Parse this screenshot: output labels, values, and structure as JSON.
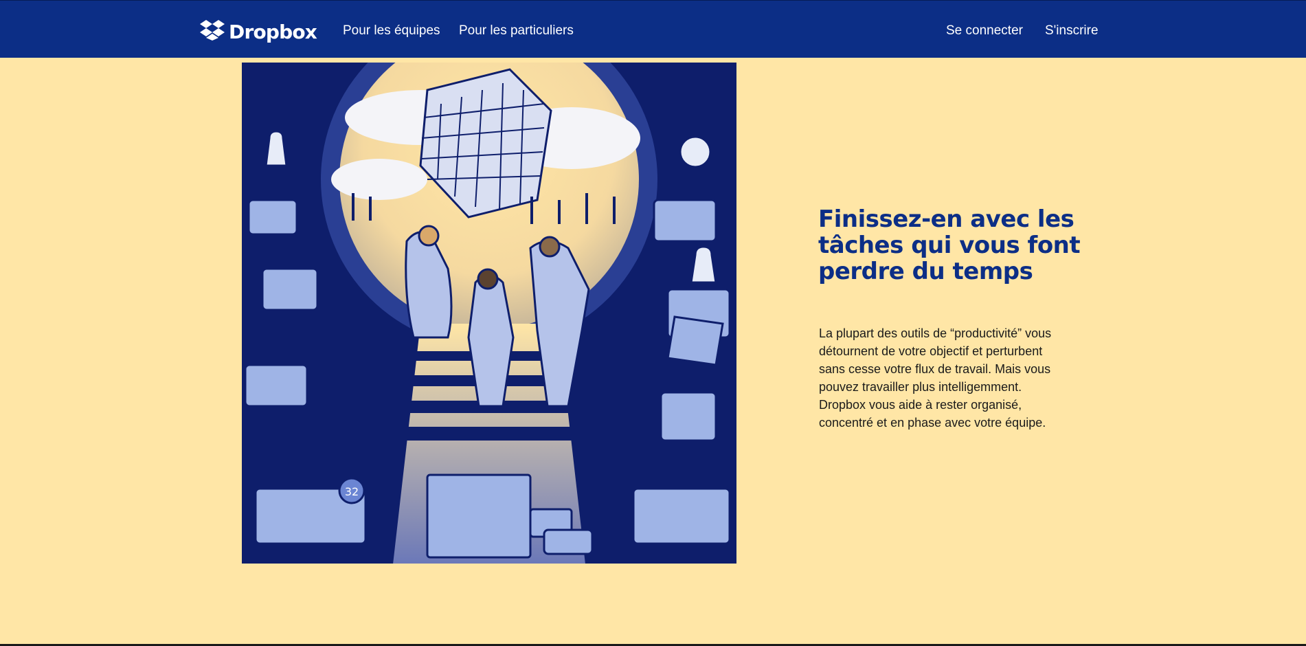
{
  "nav": {
    "logo_text": "Dropbox",
    "links": [
      {
        "label": "Pour les équipes"
      },
      {
        "label": "Pour les particuliers"
      }
    ],
    "login_label": "Se connecter",
    "signup_label": "S'inscrire"
  },
  "hero": {
    "heading": "Finissez-en avec les tâches qui vous font perdre du temps",
    "body": "La plupart des outils de “productivité” vous détournent de votre objectif et perturbent sans cesse votre flux de travail. Mais vous pouvez travailler plus intelligemment. Dropbox vous aide à rester organisé, concentré et en phase avec votre équipe.",
    "illustration_badge": "32"
  },
  "colors": {
    "nav_bg": "#0c2e86",
    "page_bg": "#ffe6a6",
    "heading": "#0c2e86",
    "illustration_dark": "#0e1e6b",
    "illustration_light": "#9fb4e6"
  },
  "icons": [
    "dropbox-logo-icon"
  ]
}
